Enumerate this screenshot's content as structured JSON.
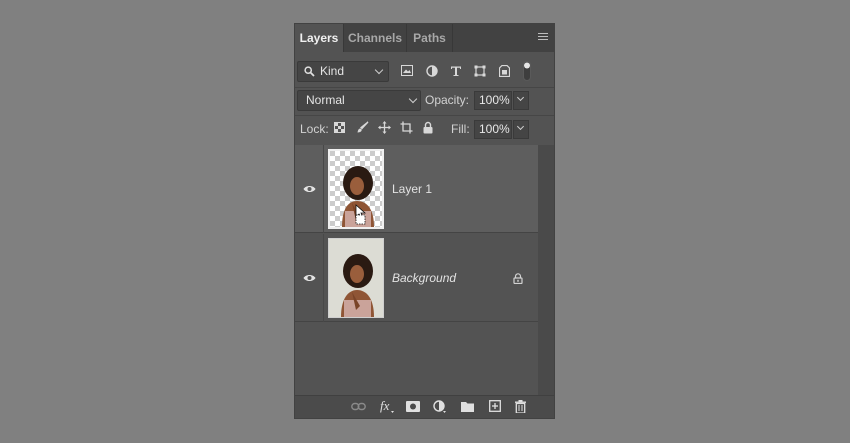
{
  "tabs": [
    {
      "label": "Layers",
      "active": true
    },
    {
      "label": "Channels",
      "active": false
    },
    {
      "label": "Paths",
      "active": false
    }
  ],
  "filter": {
    "kind_label": "Kind",
    "icons": [
      "image-filter-icon",
      "adjustment-filter-icon",
      "type-filter-icon",
      "shape-filter-icon",
      "smart-object-filter-icon",
      "filter-toggle-icon"
    ]
  },
  "blend": {
    "mode": "Normal",
    "opacity_label": "Opacity:",
    "opacity_value": "100%"
  },
  "lock": {
    "label": "Lock:",
    "icons": [
      "lock-transparent-pixels-icon",
      "lock-image-pixels-icon",
      "lock-position-icon",
      "lock-artboard-icon",
      "lock-all-icon"
    ],
    "fill_label": "Fill:",
    "fill_value": "100%"
  },
  "layers": [
    {
      "name": "Layer 1",
      "visible": true,
      "selected": true,
      "italic": false,
      "locked": false
    },
    {
      "name": "Background",
      "visible": true,
      "selected": false,
      "italic": true,
      "locked": true
    }
  ],
  "bottom_icons": [
    "link-layers-icon",
    "fx-icon",
    "add-mask-icon",
    "adjustment-layer-icon",
    "new-group-icon",
    "new-layer-icon",
    "delete-layer-icon"
  ],
  "colors": {
    "panel_bg": "#535353",
    "selected_row": "#5e5e5e",
    "text": "#d6d6d6"
  }
}
